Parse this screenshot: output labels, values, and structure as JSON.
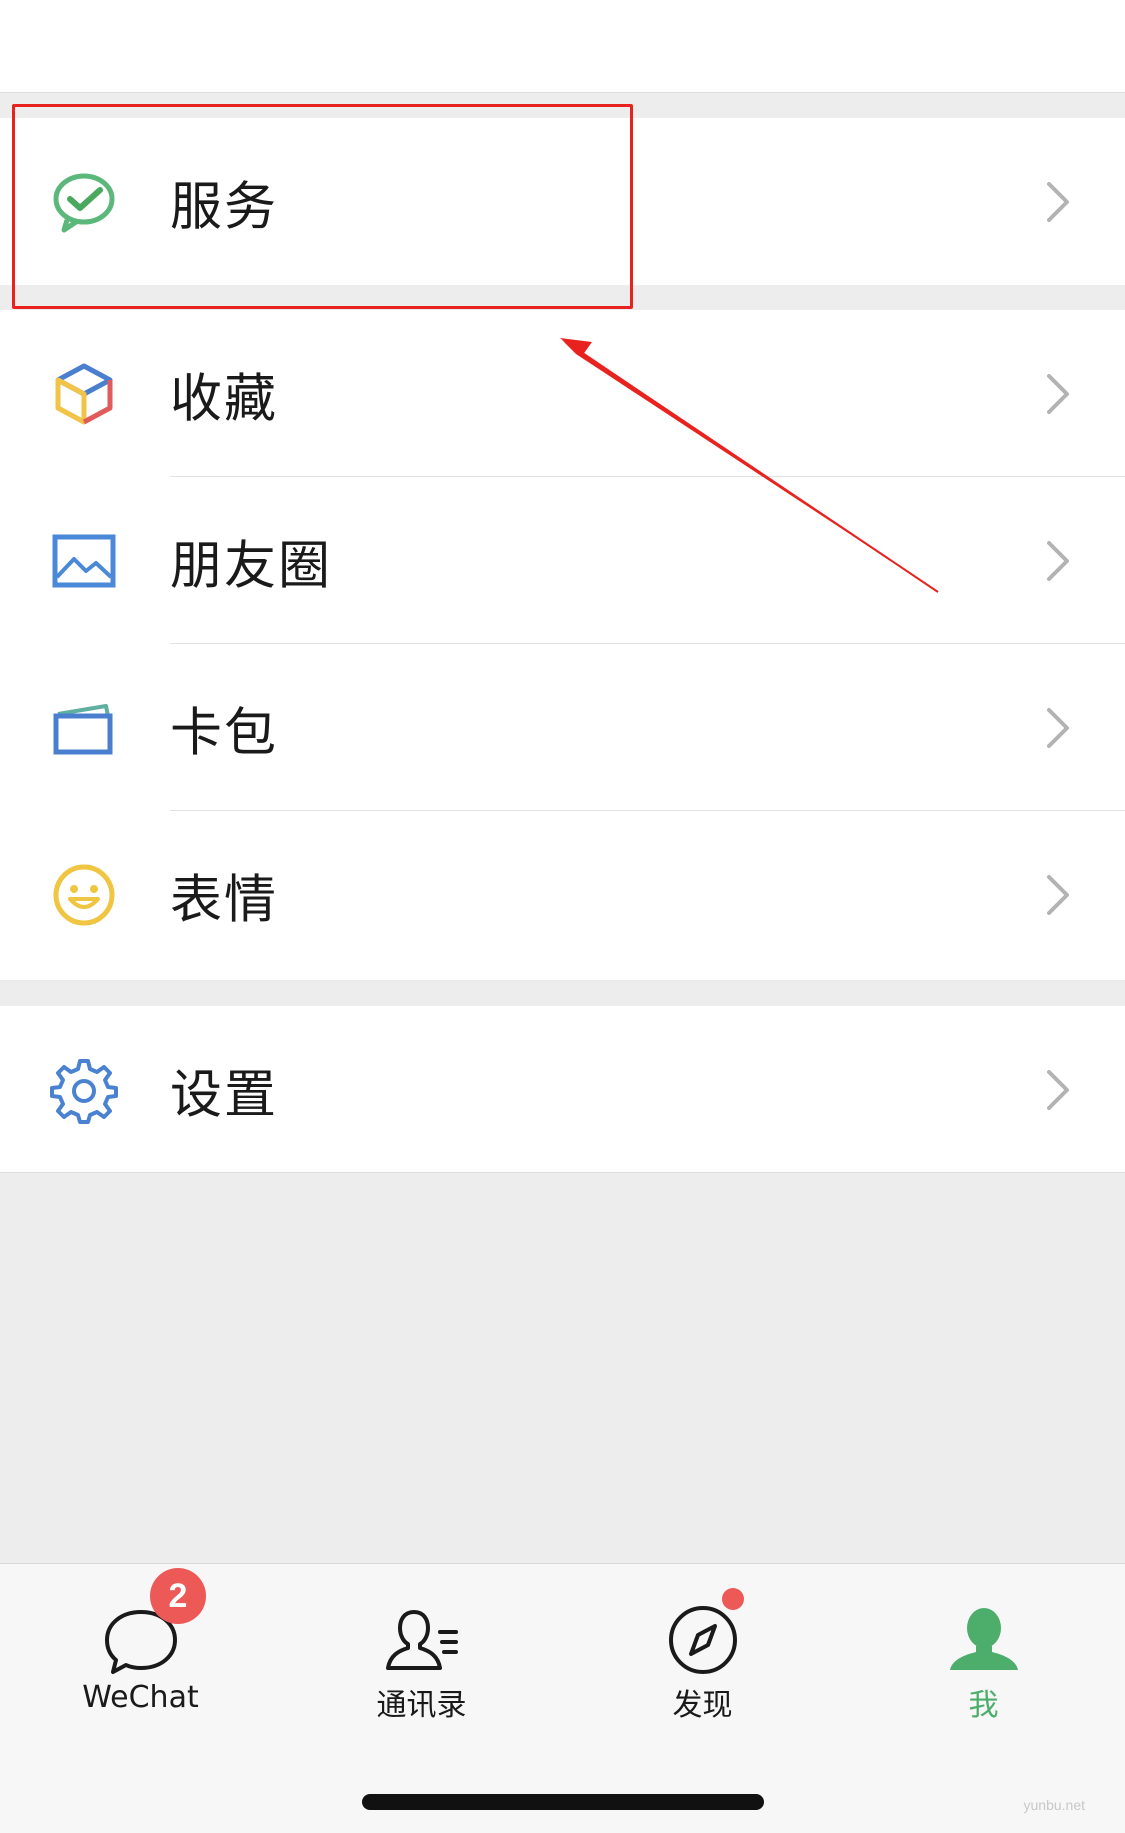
{
  "menu": {
    "services": {
      "label": "服务",
      "icon": "wechat-pay-check-icon"
    },
    "favorites": {
      "label": "收藏",
      "icon": "cube-icon"
    },
    "moments": {
      "label": "朋友圈",
      "icon": "picture-icon"
    },
    "cards": {
      "label": "卡包",
      "icon": "wallet-icon"
    },
    "stickers": {
      "label": "表情",
      "icon": "smiley-icon"
    },
    "settings": {
      "label": "设置",
      "icon": "gear-icon"
    }
  },
  "tabbar": {
    "wechat": {
      "label": "WeChat",
      "badge": "2",
      "icon": "chat-bubble-icon"
    },
    "contacts": {
      "label": "通讯录",
      "icon": "contacts-icon"
    },
    "discover": {
      "label": "发现",
      "icon": "compass-icon",
      "has_dot": true
    },
    "me": {
      "label": "我",
      "icon": "person-icon",
      "active": true
    }
  },
  "watermark": "yunbu.net",
  "colors": {
    "accent_green": "#4cae6a",
    "annotation_red": "#e8231f",
    "badge_red": "#ec5957",
    "background": "#ededed"
  }
}
